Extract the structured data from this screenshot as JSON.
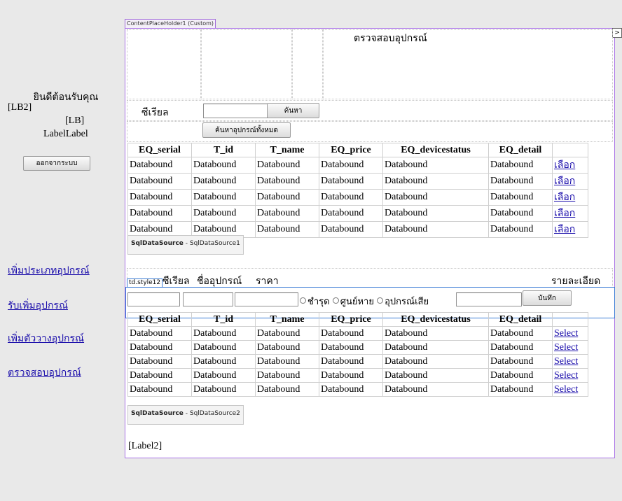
{
  "left": {
    "welcome": "ยินดีต้อนรับคุณ",
    "lb2": "[LB2]",
    "lb": "[LB]",
    "label_label": "LabelLabel",
    "logout_button": "ออกจากระบบ",
    "nav": [
      "เพิ่มประเภทอุปกรณ์",
      "รับเพิ่มอุปกรณ์",
      "เพิ่มตัววางอุปกรณ์",
      "ตรวจสอบอุปกรณ์"
    ]
  },
  "content": {
    "placeholder_tag": "ContentPlaceHolder1 (Custom)",
    "arrow": ">",
    "title": "ตรวจสอบอุปกรณ์",
    "serial_label": "ซีเรียล",
    "search_button": "ค้นหา",
    "search_all_button": "ค้นหาอุปกรณ์ทั้งหมด",
    "grid1": {
      "headers": [
        "EQ_serial",
        "T_id",
        "T_name",
        "EQ_price",
        "EQ_devicestatus",
        "EQ_detail",
        ""
      ],
      "cell": "Databound",
      "link": "เลือก",
      "rows": 5
    },
    "sds1": {
      "kind": "SqlDataSource",
      "name": " - SqlDataSource1"
    },
    "td_tag": "td.style12",
    "form_headers": {
      "serial": "ซีเรียล",
      "name": "ชื่ออุปกรณ์",
      "price": "ราคา",
      "detail": "รายละเอียด"
    },
    "status_options": [
      "ชำรุด",
      "ศูนย์หาย",
      "อุปกรณ์เสีย"
    ],
    "save_button": "บันทึก",
    "grid2": {
      "headers": [
        "EQ_serial",
        "T_id",
        "T_name",
        "EQ_price",
        "EQ_devicestatus",
        "EQ_detail",
        ""
      ],
      "cell": "Databound",
      "link": "Select",
      "rows": 5
    },
    "sds2": {
      "kind": "SqlDataSource",
      "name": " - SqlDataSource2"
    },
    "label2": "[Label2]"
  }
}
